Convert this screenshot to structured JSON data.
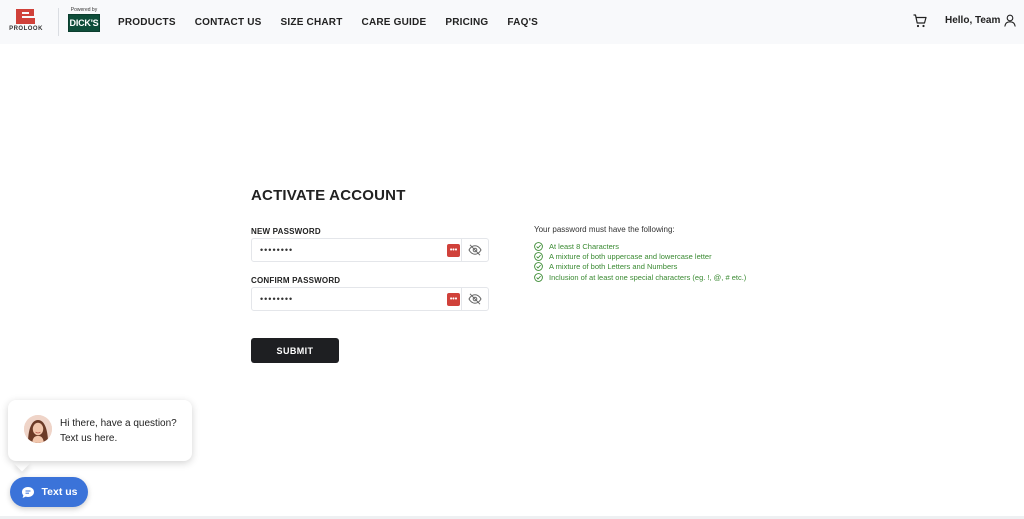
{
  "header": {
    "logo_text": "PROLOOK",
    "powered_by": "Powered by",
    "partner_badge": "DICK'S",
    "nav": [
      "PRODUCTS",
      "CONTACT US",
      "SIZE CHART",
      "CARE GUIDE",
      "PRICING",
      "FAQ'S"
    ],
    "greeting": "Hello, Team"
  },
  "form": {
    "title": "ACTIVATE ACCOUNT",
    "new_password_label": "NEW PASSWORD",
    "new_password_value": "••••••••",
    "confirm_password_label": "CONFIRM PASSWORD",
    "confirm_password_value": "••••••••",
    "submit_label": "SUBMIT"
  },
  "requirements": {
    "title": "Your password must have the following:",
    "items": [
      "At least 8 Characters",
      "A mixture of both uppercase and lowercase letter",
      "A mixture of both Letters and Numbers",
      "Inclusion of at least one special characters (eg. !, @, # etc.)"
    ]
  },
  "chat": {
    "message": "Hi there, have a question? Text us here.",
    "button_label": "Text us"
  },
  "colors": {
    "brand_red": "#d0413a",
    "dicks_green": "#0e4d3a",
    "check_green": "#3a8a32",
    "chat_blue": "#3b73d9",
    "submit_dark": "#1e1f22"
  }
}
